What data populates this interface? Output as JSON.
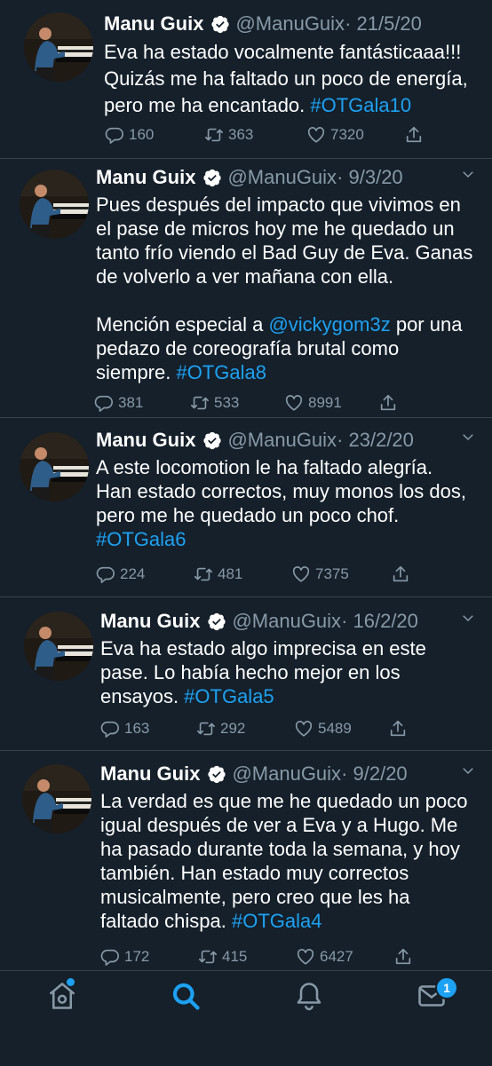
{
  "colors": {
    "background": "#15202b",
    "text": "#ffffff",
    "muted": "#8899a6",
    "accent": "#1da1f2",
    "divider": "#38444d"
  },
  "tweets": [
    {
      "name": "Manu Guix",
      "handle": "@ManuGuix",
      "date": "· 21/5/20",
      "lines": [
        "Eva ha estado vocalmente fantásticaaa!!!",
        "Quizás me ha faltado un poco de energía,",
        "pero me ha encantado. "
      ],
      "hashtag": "#OTGala10",
      "replies": "160",
      "retweets": "363",
      "likes": "7320"
    },
    {
      "name": "Manu Guix",
      "handle": "@ManuGuix",
      "date": "· 9/3/20",
      "lines": [
        "Pues después del impacto que vivimos en",
        "el pase de micros hoy me he quedado un",
        "tanto frío viendo el Bad Guy de Eva. Ganas",
        "de volverlo a ver mañana con ella."
      ],
      "mention_prefix": "Mención especial a ",
      "mention": "@vickygom3z",
      "mention_suffix": " por una",
      "lines2": [
        "pedazo de coreografía brutal como",
        "siempre. "
      ],
      "hashtag": "#OTGala8",
      "replies": "381",
      "retweets": "533",
      "likes": "8991"
    },
    {
      "name": "Manu Guix",
      "handle": "@ManuGuix",
      "date": "· 23/2/20",
      "lines": [
        "A este locomotion le ha faltado alegría.",
        "Han estado correctos, muy monos los dos,",
        "pero me he quedado un poco chof."
      ],
      "hashtag": "#OTGala6",
      "replies": "224",
      "retweets": "481",
      "likes": "7375"
    },
    {
      "name": "Manu Guix",
      "handle": "@ManuGuix",
      "date": "· 16/2/20",
      "lines": [
        "Eva ha estado algo imprecisa en este",
        "pase. Lo había hecho mejor en los",
        "ensayos. "
      ],
      "hashtag": "#OTGala5",
      "replies": "163",
      "retweets": "292",
      "likes": "5489"
    },
    {
      "name": "Manu Guix",
      "handle": "@ManuGuix",
      "date": "· 9/2/20",
      "lines": [
        "La verdad es que me he quedado un poco",
        "igual después de ver a Eva y a Hugo. Me",
        "ha pasado durante toda la semana, y hoy",
        "también. Han estado muy correctos",
        "musicalmente, pero creo que les ha",
        "faltado chispa. "
      ],
      "hashtag": "#OTGala4",
      "replies": "172",
      "retweets": "415",
      "likes": "6427"
    }
  ],
  "tabbar": {
    "messages_badge": "1"
  },
  "icons": [
    "home-icon",
    "search-icon",
    "bell-icon",
    "mail-icon",
    "reply-icon",
    "retweet-icon",
    "heart-icon",
    "share-icon",
    "verified-badge-icon",
    "chevron-down-icon"
  ]
}
